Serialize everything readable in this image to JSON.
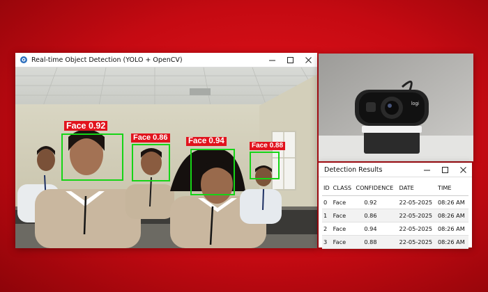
{
  "main_window": {
    "title": "Real-time Object Detection (YOLO + OpenCV)",
    "detections": [
      {
        "label": "Face 0.92"
      },
      {
        "label": "Face 0.86"
      },
      {
        "label": "Face 0.94"
      },
      {
        "label": "Face 0.88"
      }
    ]
  },
  "results_window": {
    "title": "Detection Results",
    "columns": [
      "ID",
      "CLASS",
      "CONFIDENCE",
      "DATE",
      "TIME"
    ],
    "rows": [
      [
        "0",
        "Face",
        "0.92",
        "22-05-2025",
        "08:26 AM"
      ],
      [
        "1",
        "Face",
        "0.86",
        "22-05-2025",
        "08:26 AM"
      ],
      [
        "2",
        "Face",
        "0.94",
        "22-05-2025",
        "08:26 AM"
      ],
      [
        "3",
        "Face",
        "0.88",
        "22-05-2025",
        "08:26 AM"
      ]
    ]
  },
  "webcam": {
    "brand": "logi"
  },
  "colors": {
    "box": "#16d416",
    "label_bg": "#e1131d",
    "background": "#d10d15"
  },
  "icons": [
    "app-icon",
    "minimize-icon",
    "maximize-icon",
    "close-icon"
  ]
}
